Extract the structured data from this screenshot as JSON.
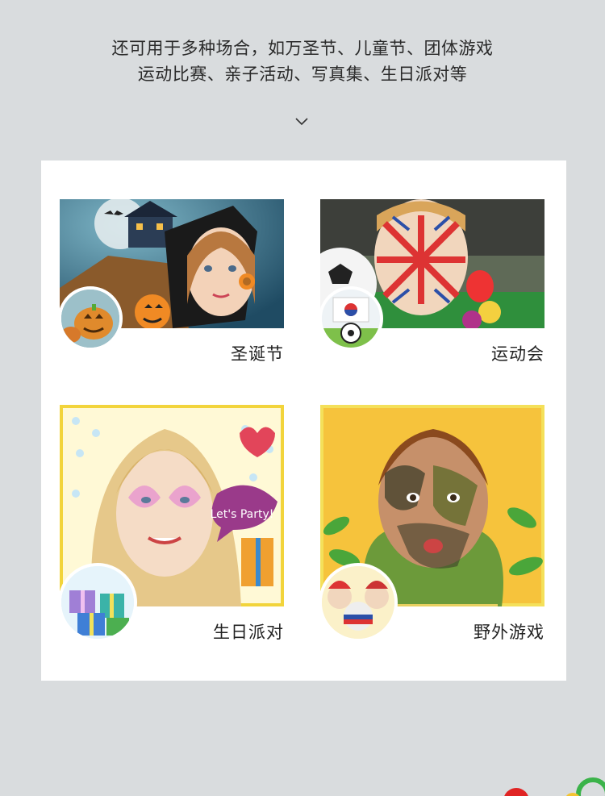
{
  "intro": {
    "line1": "还可用于多种场合，如万圣节、儿童节、团体游戏",
    "line2": "运动比赛、亲子活动、写真集、生日派对等"
  },
  "chevron_icon": "chevron-down-icon",
  "occasions": [
    {
      "label": "圣诞节",
      "theme": "halloween"
    },
    {
      "label": "运动会",
      "theme": "sports"
    },
    {
      "label": "生日派对",
      "theme": "birthday"
    },
    {
      "label": "野外游戏",
      "theme": "outdoor"
    }
  ],
  "birthday_bubble": "Let's Party!",
  "colors": {
    "background": "#d9dcde",
    "panel": "#ffffff",
    "text": "#222222"
  }
}
